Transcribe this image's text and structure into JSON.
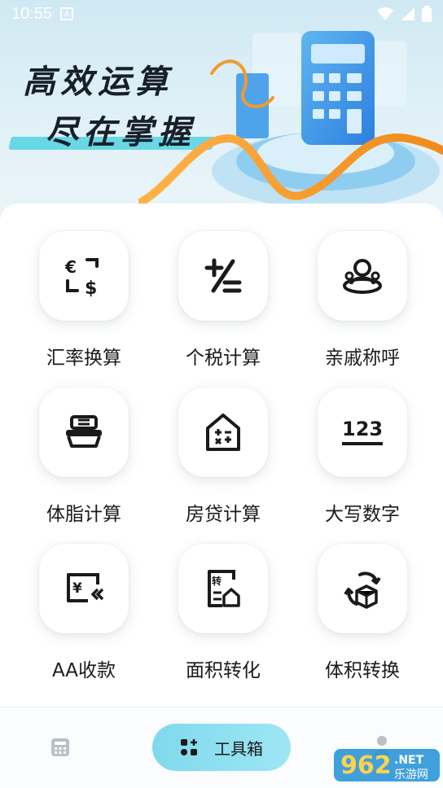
{
  "status_bar": {
    "time": "10:55",
    "notification_glyph": "A"
  },
  "banner": {
    "line1": "高效运算",
    "line2": "尽在掌握"
  },
  "tools": [
    {
      "label": "汇率换算",
      "icon": "currency-exchange-icon"
    },
    {
      "label": "个税计算",
      "icon": "tax-calc-icon"
    },
    {
      "label": "亲戚称呼",
      "icon": "relatives-icon"
    },
    {
      "label": "体脂计算",
      "icon": "body-fat-scale-icon"
    },
    {
      "label": "房贷计算",
      "icon": "mortgage-house-icon"
    },
    {
      "label": "大写数字",
      "icon": "number-123-icon"
    },
    {
      "label": "AA收款",
      "icon": "split-bill-icon"
    },
    {
      "label": "面积转化",
      "icon": "area-convert-icon"
    },
    {
      "label": "体积转换",
      "icon": "volume-convert-icon"
    }
  ],
  "nav": {
    "active_tab_label": "工具箱"
  },
  "watermark": {
    "text_main": "962",
    "text_net": ".NET",
    "text_cn": "乐游网"
  },
  "colors": {
    "accent": "#7fd9ec",
    "text": "#1a1a1a",
    "banner_bar": "#67d8e4",
    "orange": "#f39a2c"
  }
}
